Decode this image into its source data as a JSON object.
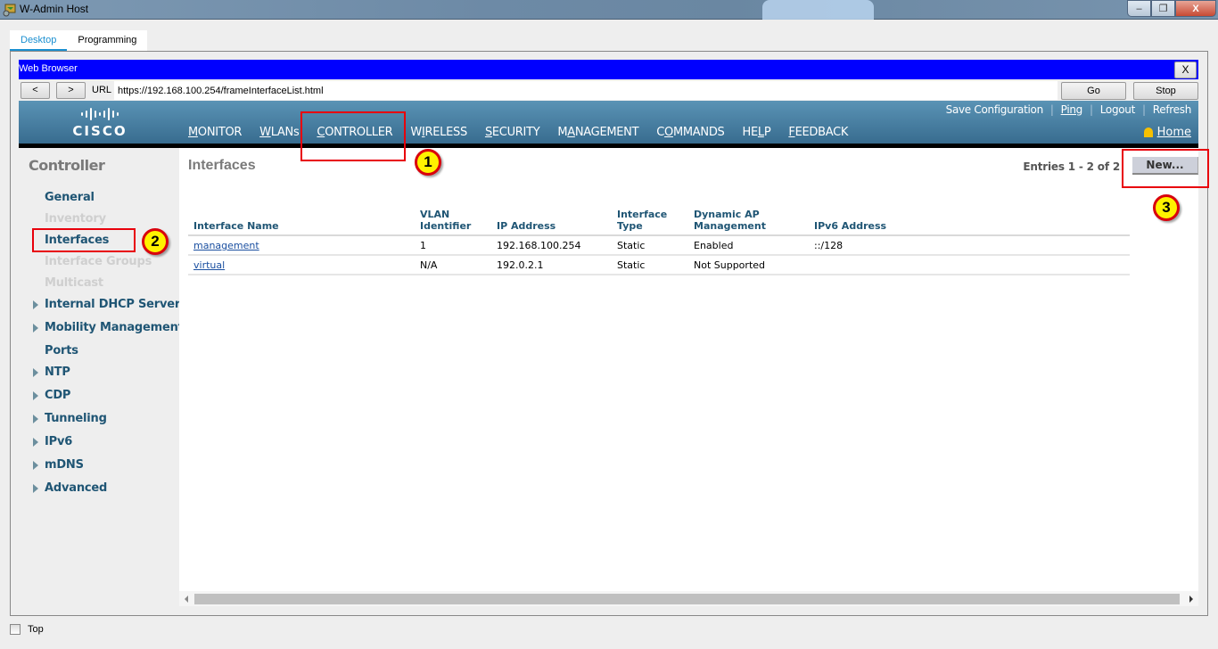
{
  "window": {
    "title": "W-Admin Host",
    "controls": {
      "minimize": "–",
      "restore": "❐",
      "close": "X"
    }
  },
  "tabs": [
    {
      "label": "Desktop",
      "active": true
    },
    {
      "label": "Programming",
      "active": false
    }
  ],
  "browser": {
    "title": "Web Browser",
    "close_label": "X",
    "back_label": "<",
    "forward_label": ">",
    "url_label": "URL",
    "url": "https://192.168.100.254/frameInterfaceList.html",
    "go_label": "Go",
    "stop_label": "Stop"
  },
  "header": {
    "logo_text": "CISCO",
    "nav": [
      {
        "label": "MONITOR",
        "underline_index": 0
      },
      {
        "label": "WLANs",
        "underline_index": 0
      },
      {
        "label": "CONTROLLER",
        "underline_index": 0,
        "active": true
      },
      {
        "label": "WIRELESS",
        "underline_index": 1
      },
      {
        "label": "SECURITY",
        "underline_index": 0
      },
      {
        "label": "MANAGEMENT",
        "underline_index": 1
      },
      {
        "label": "COMMANDS",
        "underline_index": 1
      },
      {
        "label": "HELP",
        "underline_index": 2
      },
      {
        "label": "FEEDBACK",
        "underline_index": 0
      }
    ],
    "links": {
      "save": "Save Configuration",
      "ping": "Ping",
      "logout": "Logout",
      "refresh": "Refresh",
      "separator": "|"
    },
    "home": "Home",
    "active_color": "#ff9900"
  },
  "sidebar": {
    "heading": "Controller",
    "items": [
      {
        "label": "General",
        "enabled": true,
        "expandable": false
      },
      {
        "label": "Inventory",
        "enabled": false,
        "expandable": false
      },
      {
        "label": "Interfaces",
        "enabled": true,
        "expandable": false
      },
      {
        "label": "Interface Groups",
        "enabled": false,
        "expandable": false
      },
      {
        "label": "Multicast",
        "enabled": false,
        "expandable": false
      },
      {
        "label": "Internal DHCP Server",
        "enabled": true,
        "expandable": true
      },
      {
        "label": "Mobility Management",
        "enabled": true,
        "expandable": true
      },
      {
        "label": "Ports",
        "enabled": true,
        "expandable": false
      },
      {
        "label": "NTP",
        "enabled": true,
        "expandable": true
      },
      {
        "label": "CDP",
        "enabled": true,
        "expandable": true
      },
      {
        "label": "Tunneling",
        "enabled": true,
        "expandable": true
      },
      {
        "label": "IPv6",
        "enabled": true,
        "expandable": true
      },
      {
        "label": "mDNS",
        "enabled": true,
        "expandable": true
      },
      {
        "label": "Advanced",
        "enabled": true,
        "expandable": true
      }
    ]
  },
  "main": {
    "title": "Interfaces",
    "entries": "Entries 1 - 2 of 2",
    "new_button": "New...",
    "table": {
      "headers": {
        "name": "Interface Name",
        "vlan_1": "VLAN",
        "vlan_2": "Identifier",
        "ip": "IP Address",
        "type_1": "Interface",
        "type_2": "Type",
        "dyn_1": "Dynamic AP",
        "dyn_2": "Management",
        "ipv6": "IPv6 Address"
      },
      "rows": [
        {
          "name": "management",
          "vlan": "1",
          "ip": "192.168.100.254",
          "type": "Static",
          "dynamic": "Enabled",
          "ipv6": "::/128"
        },
        {
          "name": "virtual",
          "vlan": "N/A",
          "ip": "192.0.2.1",
          "type": "Static",
          "dynamic": "Not Supported",
          "ipv6": ""
        }
      ]
    }
  },
  "annotations": [
    {
      "number": "1",
      "target": "CONTROLLER"
    },
    {
      "number": "2",
      "target": "Interfaces"
    },
    {
      "number": "3",
      "target": "New..."
    }
  ],
  "footer": {
    "top_checkbox_label": "Top",
    "top_checked": false
  }
}
